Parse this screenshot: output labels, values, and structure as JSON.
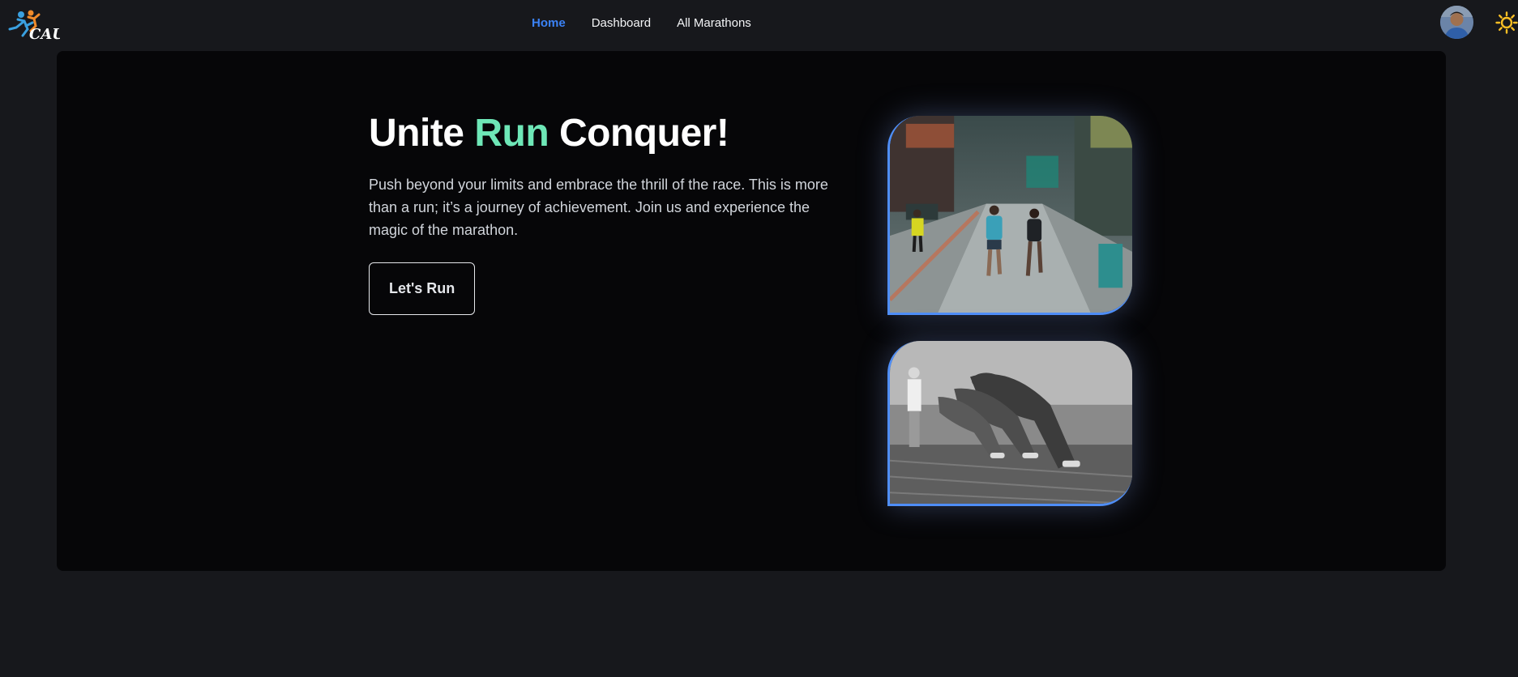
{
  "nav": {
    "logo_text": "CAU",
    "links": [
      {
        "label": "Home",
        "active": true
      },
      {
        "label": "Dashboard",
        "active": false
      },
      {
        "label": "All Marathons",
        "active": false
      }
    ],
    "theme_icon": "sun-icon"
  },
  "hero": {
    "title_part1": "Unite ",
    "title_accent": "Run",
    "title_part2": " Conquer!",
    "description": "Push beyond your limits and embrace the thrill of the race. This is more than a run; it’s a journey of achievement. Join us and experience the magic of the marathon.",
    "cta_label": "Let's Run",
    "images": [
      {
        "name": "city-marathon-runners-image"
      },
      {
        "name": "sprint-start-runners-image"
      }
    ]
  },
  "colors": {
    "page_bg": "#17181c",
    "hero_bg": "#060608",
    "accent_green": "#6ee7b7",
    "active_link": "#3b82f6",
    "image_border": "#4f8ef7",
    "sun": "#fbbf24"
  }
}
